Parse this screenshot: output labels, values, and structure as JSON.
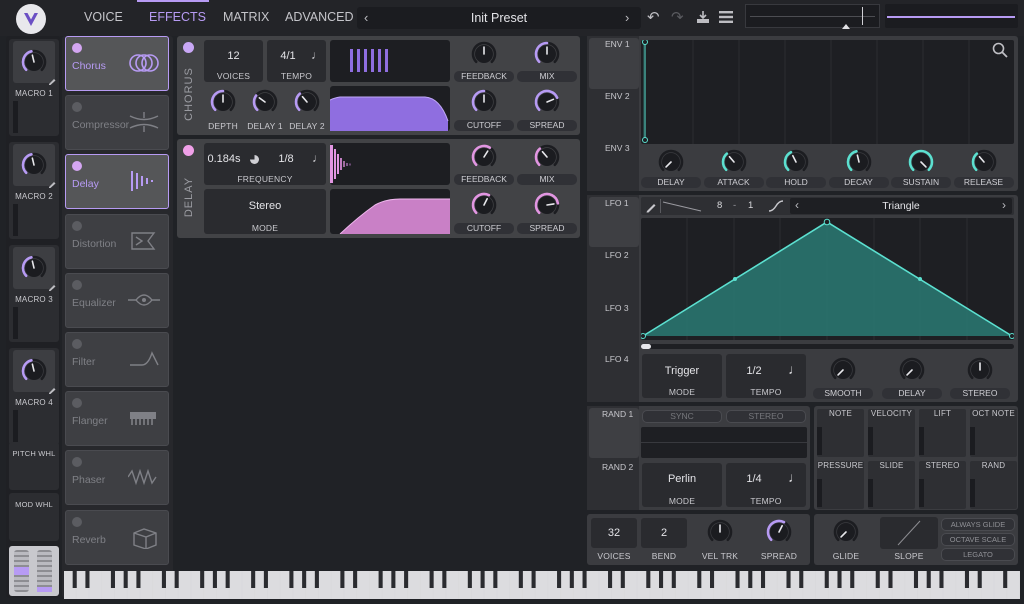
{
  "tabs": [
    {
      "label": "VOICE",
      "active": false
    },
    {
      "label": "EFFECTS",
      "active": true
    },
    {
      "label": "MATRIX",
      "active": false
    },
    {
      "label": "ADVANCED",
      "active": false
    }
  ],
  "preset": {
    "name": "Init Preset"
  },
  "macros": [
    {
      "label": "MACRO 1"
    },
    {
      "label": "MACRO 2"
    },
    {
      "label": "MACRO 3"
    },
    {
      "label": "MACRO 4"
    }
  ],
  "wheels": {
    "pitch": "PITCH WHL",
    "mod": "MOD WHL"
  },
  "effects": [
    {
      "name": "Chorus",
      "on": true
    },
    {
      "name": "Compressor",
      "on": false
    },
    {
      "name": "Delay",
      "on": true
    },
    {
      "name": "Distortion",
      "on": false
    },
    {
      "name": "Equalizer",
      "on": false
    },
    {
      "name": "Filter",
      "on": false
    },
    {
      "name": "Flanger",
      "on": false
    },
    {
      "name": "Phaser",
      "on": false
    },
    {
      "name": "Reverb",
      "on": false
    }
  ],
  "chorus": {
    "title": "CHORUS",
    "voices_value": "12",
    "voices_label": "VOICES",
    "tempo_value": "4/1",
    "tempo_label": "TEMPO",
    "feedback_label": "FEEDBACK",
    "mix_label": "MIX",
    "depth_label": "DEPTH",
    "delay1_label": "DELAY 1",
    "delay2_label": "DELAY 2",
    "cutoff_label": "CUTOFF",
    "spread_label": "SPREAD"
  },
  "delay": {
    "title": "DELAY",
    "freq_value": "0.184s",
    "tempo_value": "1/8",
    "freq_label": "FREQUENCY",
    "feedback_label": "FEEDBACK",
    "mix_label": "MIX",
    "mode_value": "Stereo",
    "mode_label": "MODE",
    "cutoff_label": "CUTOFF",
    "spread_label": "SPREAD"
  },
  "env": {
    "tabs": [
      "ENV 1",
      "ENV 2",
      "ENV 3"
    ],
    "knobs": [
      "DELAY",
      "ATTACK",
      "HOLD",
      "DECAY",
      "SUSTAIN",
      "RELEASE"
    ]
  },
  "lfo": {
    "tabs": [
      "LFO 1",
      "LFO 2",
      "LFO 3",
      "LFO 4"
    ],
    "grid_x": "8",
    "grid_sep": "-",
    "grid_y": "1",
    "shape": "Triangle",
    "mode_value": "Trigger",
    "mode_label": "MODE",
    "tempo_value": "1/2",
    "tempo_label": "TEMPO",
    "smooth_label": "SMOOTH",
    "delay_label": "DELAY",
    "stereo_label": "STEREO"
  },
  "rand": {
    "tabs": [
      "RAND 1",
      "RAND 2"
    ],
    "sync": "SYNC",
    "stereo": "STEREO",
    "mode_value": "Perlin",
    "mode_label": "MODE",
    "tempo_value": "1/4",
    "tempo_label": "TEMPO"
  },
  "sources": [
    "NOTE",
    "VELOCITY",
    "LIFT",
    "OCT NOTE",
    "PRESSURE",
    "SLIDE",
    "STEREO",
    "RAND"
  ],
  "voice": {
    "voices_value": "32",
    "voices_label": "VOICES",
    "bend_value": "2",
    "bend_label": "BEND",
    "veltrk_label": "VEL TRK",
    "spread_label": "SPREAD"
  },
  "glide": {
    "glide_label": "GLIDE",
    "slope_label": "SLOPE",
    "always_glide": "ALWAYS GLIDE",
    "octave_scale": "OCTAVE SCALE",
    "legato": "LEGATO"
  },
  "colors": {
    "accent": "#b79bf4",
    "delay": "#e296e2",
    "lfo": "#5ce0d0",
    "bg": "#202226"
  }
}
